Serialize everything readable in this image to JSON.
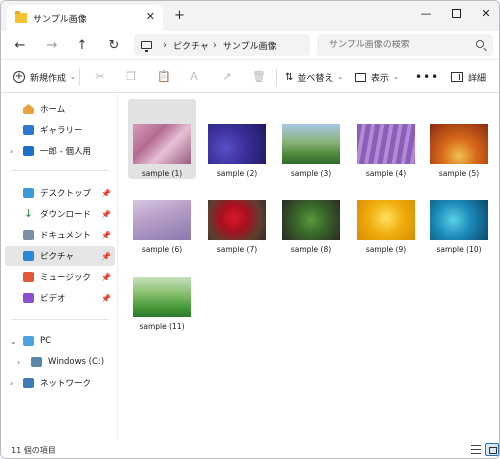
{
  "window": {
    "tab_title": "サンプル画像",
    "tab_close": "✕",
    "new_tab": "+",
    "minimize": "—",
    "close": "✕"
  },
  "nav": {
    "back": "←",
    "forward": "→",
    "up": "↑",
    "refresh": "↻"
  },
  "address": {
    "separator": "›",
    "breadcrumbs": [
      "ピクチャ",
      "サンプル画像"
    ]
  },
  "search": {
    "placeholder": "サンプル画像の検索"
  },
  "toolbar": {
    "new_label": "新規作成",
    "new_icon": "+",
    "sort_label": "並べ替え",
    "sort_icon": "⇅",
    "view_label": "表示",
    "more": "•••",
    "details_label": "詳細",
    "chevron": "⌄",
    "icons": {
      "cut": "✂",
      "copy": "❐",
      "paste": "📋",
      "rename": "Ａ",
      "share": "↗",
      "delete": "🗑"
    }
  },
  "sidebar": {
    "expand_glyph": "›",
    "expanded_glyph": "⌄",
    "pin_glyph": "📌",
    "items": [
      {
        "label": "ホーム",
        "icon": "home-icon"
      },
      {
        "label": "ギャラリー",
        "icon": "gallery-icon"
      },
      {
        "label": "一郎 - 個人用",
        "icon": "onedrive-icon"
      },
      {
        "label": "デスクトップ",
        "icon": "desktop-icon"
      },
      {
        "label": "ダウンロード",
        "icon": "download-icon"
      },
      {
        "label": "ドキュメント",
        "icon": "documents-icon"
      },
      {
        "label": "ピクチャ",
        "icon": "pictures-icon"
      },
      {
        "label": "ミュージック",
        "icon": "music-icon"
      },
      {
        "label": "ビデオ",
        "icon": "videos-icon"
      },
      {
        "label": "PC",
        "icon": "pc-icon"
      },
      {
        "label": "Windows (C:)",
        "icon": "drive-icon"
      },
      {
        "label": "ネットワーク",
        "icon": "network-icon"
      }
    ]
  },
  "files": [
    {
      "name": "sample (1)"
    },
    {
      "name": "sample (2)"
    },
    {
      "name": "sample (3)"
    },
    {
      "name": "sample (4)"
    },
    {
      "name": "sample (5)"
    },
    {
      "name": "sample (6)"
    },
    {
      "name": "sample (7)"
    },
    {
      "name": "sample (8)"
    },
    {
      "name": "sample (9)"
    },
    {
      "name": "sample (10)"
    },
    {
      "name": "sample (11)"
    }
  ],
  "status": {
    "item_count": "11 個の項目"
  },
  "colors": {
    "accent": "#2a6fc0",
    "selection": "#e2e2e2"
  }
}
